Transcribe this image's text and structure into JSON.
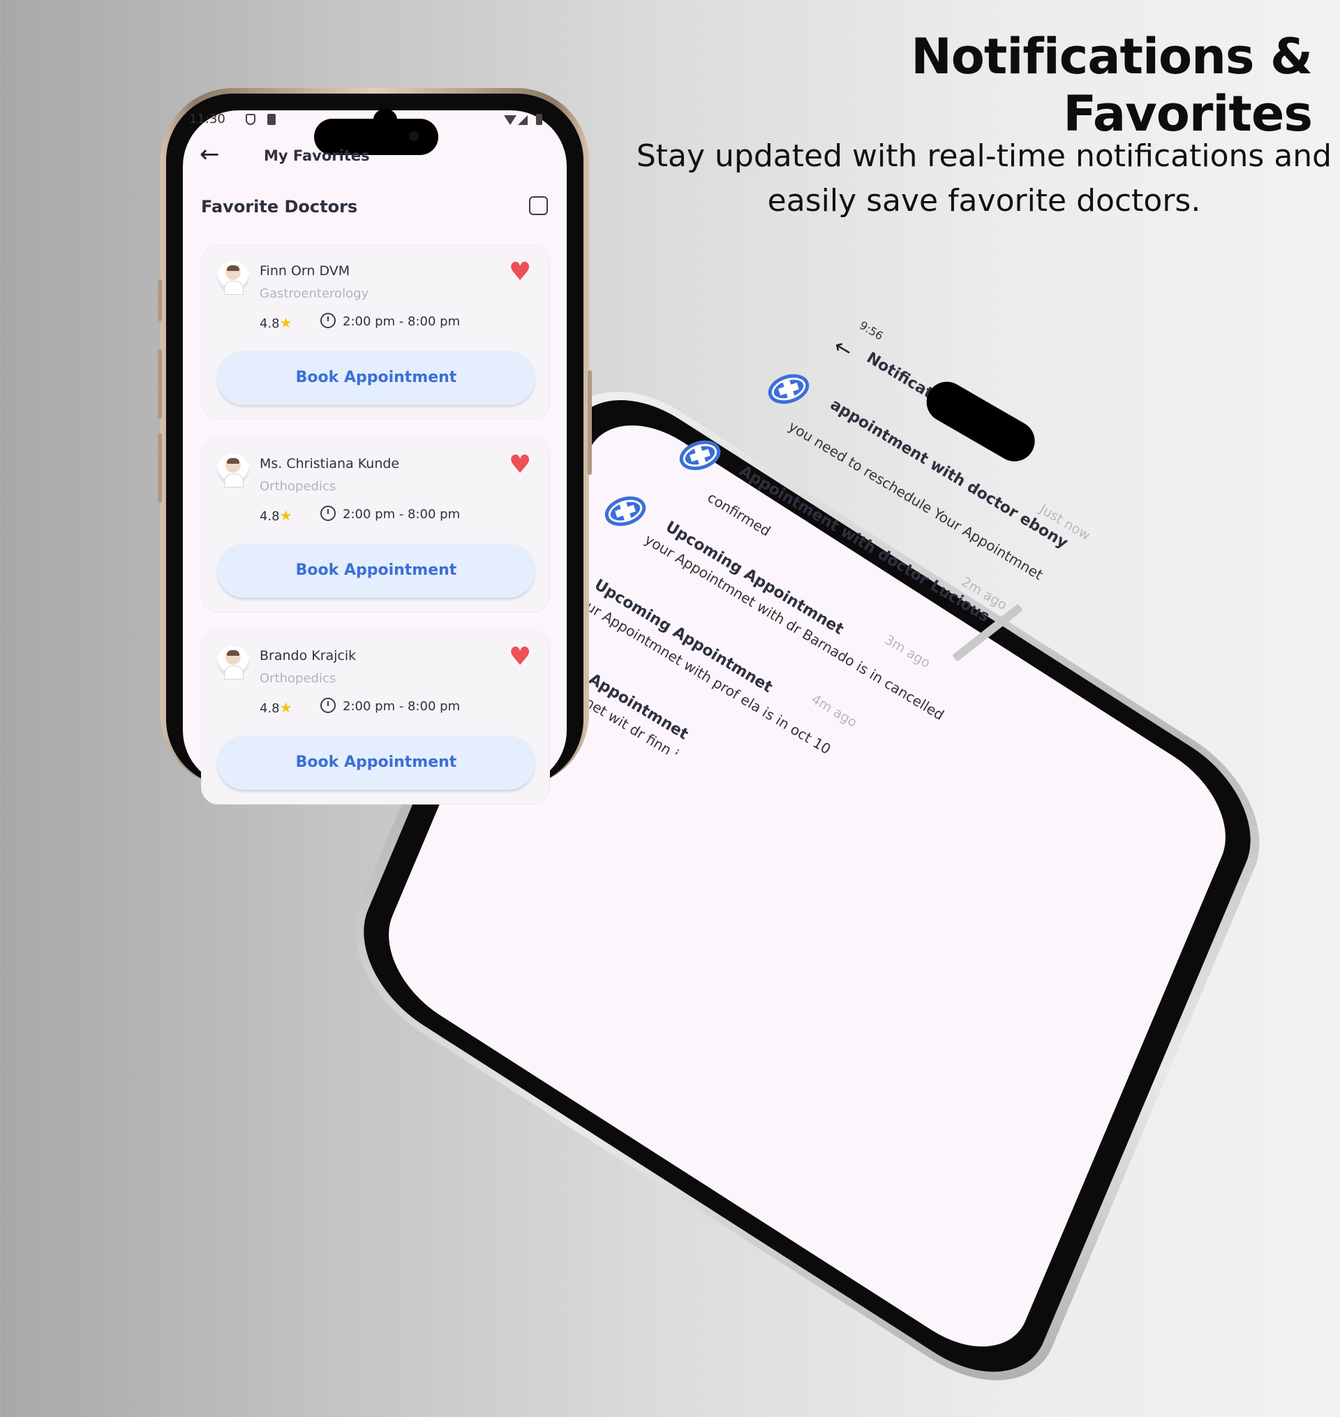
{
  "headline": "Notifications & Favorites",
  "subline": {
    "line1": "Stay updated with real-time notifications and",
    "line2": "easily save favorite doctors."
  },
  "favorites_screen": {
    "status_time": "11:30",
    "title": "My Favorites",
    "section_title": "Favorite Doctors",
    "book_label": "Book Appointment",
    "doctors": [
      {
        "name": "Finn Orn DVM",
        "specialty": "Gastroenterology",
        "rating": "4.8",
        "hours": "2:00 pm - 8:00 pm"
      },
      {
        "name": "Ms. Christiana Kunde",
        "specialty": "Orthopedics",
        "rating": "4.8",
        "hours": "2:00 pm - 8:00 pm"
      },
      {
        "name": "Brando Krajcik",
        "specialty": "Orthopedics",
        "rating": "4.8",
        "hours": "2:00 pm - 8:00 pm"
      }
    ],
    "colors": {
      "heart": "#ef4f56",
      "star": "#f4c20d",
      "button_text": "#3b6fd8",
      "button_bg": "#e5eefc"
    }
  },
  "notifications_screen": {
    "status_time": "9:56",
    "title": "Notifications",
    "items": [
      {
        "title": "appointment with doctor ebony",
        "body": "you need to reschedule Your Appointmnet",
        "time": "Just now"
      },
      {
        "title": "Appointment with doctor Lucious",
        "body": "confirmed",
        "time": "2m ago"
      },
      {
        "title": "Upcoming Appointmnet",
        "body": "your Appointmnet with dr Barnado is in cancelled",
        "time": "3m ago"
      },
      {
        "title": "Upcoming Appointmnet",
        "body": "ur Appointmnet with prof ela is in oct 10",
        "time": "4m ago"
      },
      {
        "title": "Appointmnet",
        "body": "net wit dr finn is",
        "time": ""
      }
    ]
  },
  "icons": [
    "back-arrow-icon",
    "checkbox-icon",
    "heart-icon",
    "star-icon",
    "clock-icon",
    "medical-cross-icon",
    "shield-icon",
    "sim-icon",
    "wifi-icon",
    "signal-icon",
    "battery-icon"
  ]
}
